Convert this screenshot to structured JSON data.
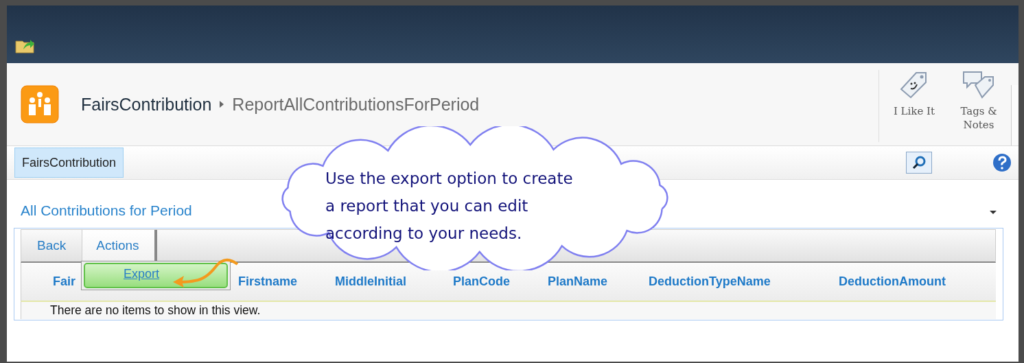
{
  "site": {
    "title": "FairsContribution",
    "page": "ReportAllContributionsForPeriod"
  },
  "ribbon_buttons": [
    {
      "kind": "like",
      "label": "I Like It"
    },
    {
      "kind": "tags",
      "label": "Tags & Notes"
    }
  ],
  "nav": {
    "items": [
      {
        "label": "FairsContribution",
        "selected": true
      }
    ]
  },
  "view_title": "All Contributions for Period",
  "toolbar": {
    "tabs": [
      {
        "label": "Back",
        "selected": false
      },
      {
        "label": "Actions",
        "selected": true
      }
    ]
  },
  "menu": {
    "items": [
      {
        "label": "Export",
        "selected": true
      }
    ]
  },
  "table": {
    "columns": [
      "Fair",
      "Firstname",
      "MiddleInitial",
      "PlanCode",
      "PlanName",
      "DeductionTypeName",
      "DeductionAmount"
    ],
    "empty_message": "There are no items to show in this view."
  },
  "callout": {
    "lines": [
      "Use the export option to create",
      "a report that you can edit",
      "according to your needs."
    ]
  }
}
